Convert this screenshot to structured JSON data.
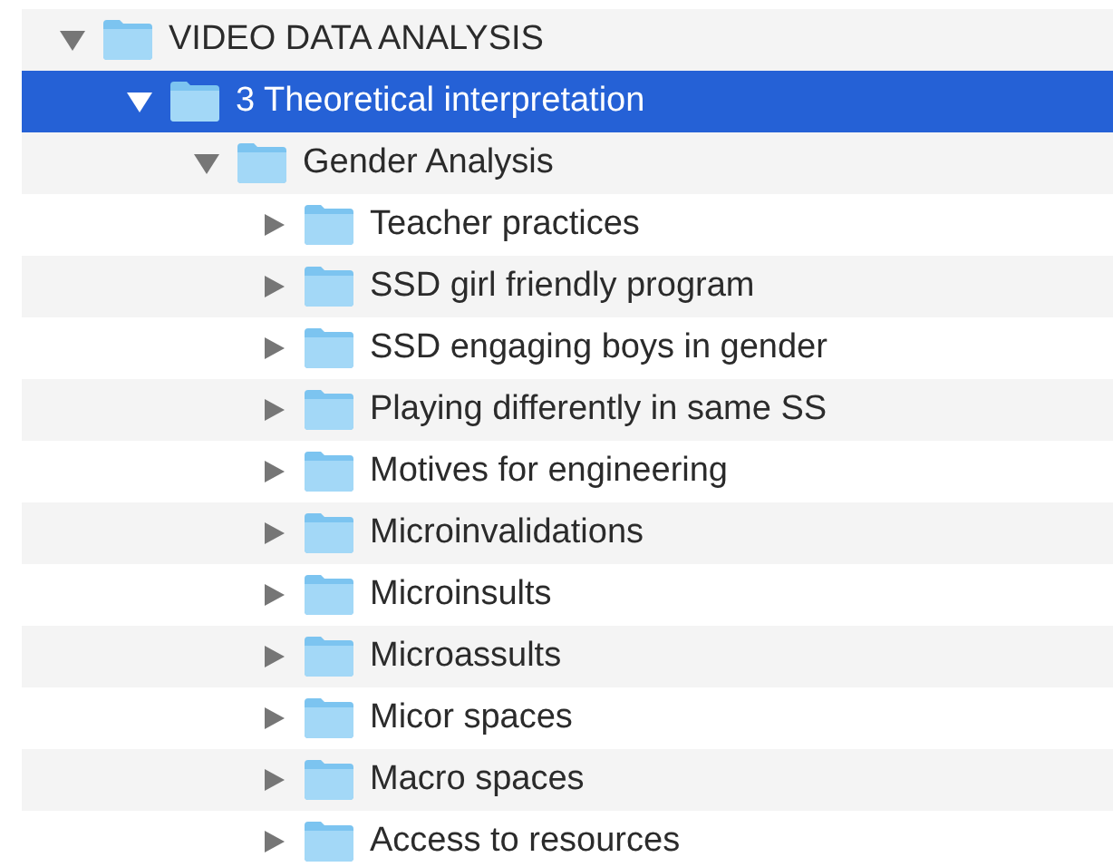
{
  "tree": [
    {
      "label": "VIDEO DATA ANALYSIS",
      "expanded": true,
      "selected": false,
      "children": [
        {
          "label": "3 Theoretical interpretation",
          "expanded": true,
          "selected": true,
          "children": [
            {
              "label": "Gender Analysis",
              "expanded": true,
              "selected": false,
              "children": [
                {
                  "label": "Teacher practices",
                  "expanded": false,
                  "selected": false
                },
                {
                  "label": "SSD girl friendly program",
                  "expanded": false,
                  "selected": false
                },
                {
                  "label": "SSD engaging boys in gender",
                  "expanded": false,
                  "selected": false
                },
                {
                  "label": "Playing differently in same SS",
                  "expanded": false,
                  "selected": false
                },
                {
                  "label": "Motives for engineering",
                  "expanded": false,
                  "selected": false
                },
                {
                  "label": "Microinvalidations",
                  "expanded": false,
                  "selected": false
                },
                {
                  "label": "Microinsults",
                  "expanded": false,
                  "selected": false
                },
                {
                  "label": "Microassults",
                  "expanded": false,
                  "selected": false
                },
                {
                  "label": "Micor spaces",
                  "expanded": false,
                  "selected": false
                },
                {
                  "label": "Macro spaces",
                  "expanded": false,
                  "selected": false
                },
                {
                  "label": "Access to resources",
                  "expanded": false,
                  "selected": false
                }
              ]
            }
          ]
        }
      ]
    }
  ]
}
